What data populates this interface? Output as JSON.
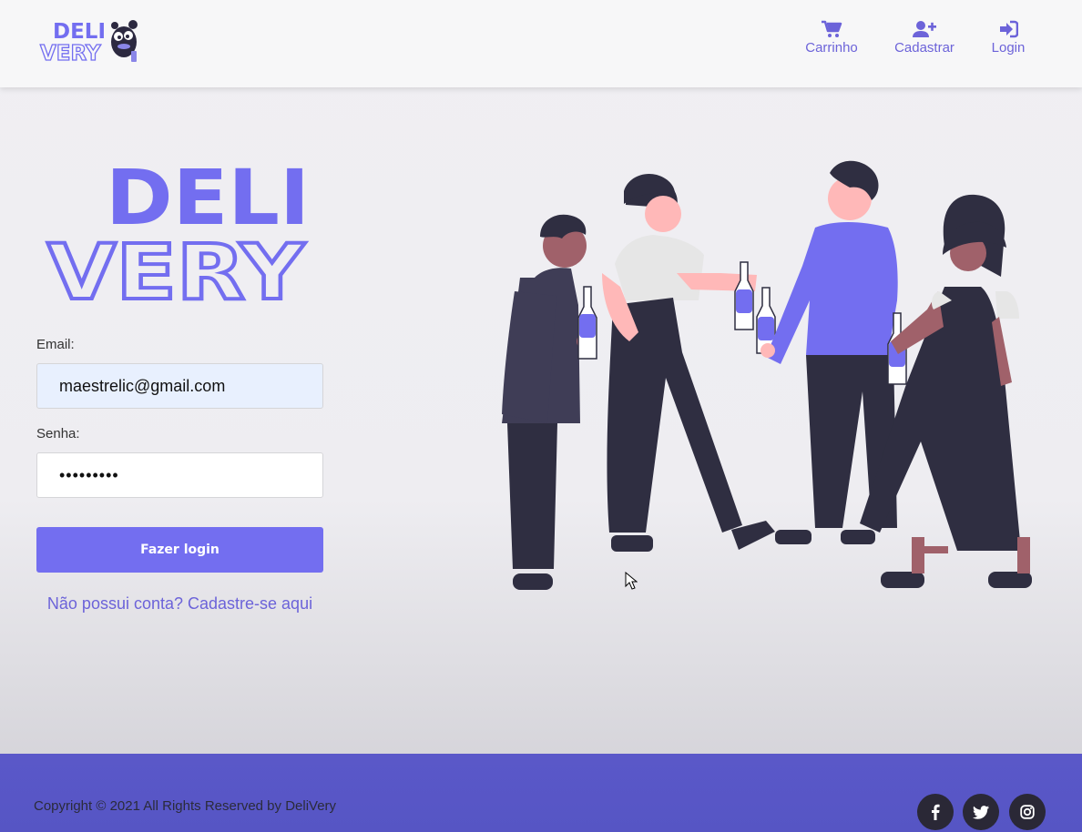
{
  "brand": {
    "logo_top": "DELI",
    "logo_bottom": "VERY"
  },
  "colors": {
    "accent": "#736ef0",
    "link": "#6c63d9",
    "footer": "#5856c6",
    "dark": "#2a2836"
  },
  "nav": {
    "cart": {
      "label": "Carrinho",
      "icon": "cart-icon"
    },
    "register": {
      "label": "Cadastrar",
      "icon": "user-plus-icon"
    },
    "login": {
      "label": "Login",
      "icon": "sign-in-icon"
    }
  },
  "hero_logo": {
    "top": "DELI",
    "bottom": "VERY"
  },
  "form": {
    "email_label": "Email:",
    "email_value": "maestrelic@gmail.com",
    "password_label": "Senha:",
    "password_value": "•••••••••",
    "submit_label": "Fazer login",
    "signup_link": "Não possui conta? Cadastre-se aqui"
  },
  "footer": {
    "copyright": "Copyright © 2021 All Rights Reserved by DeliVery",
    "social": [
      "facebook-icon",
      "twitter-icon",
      "instagram-icon"
    ]
  }
}
